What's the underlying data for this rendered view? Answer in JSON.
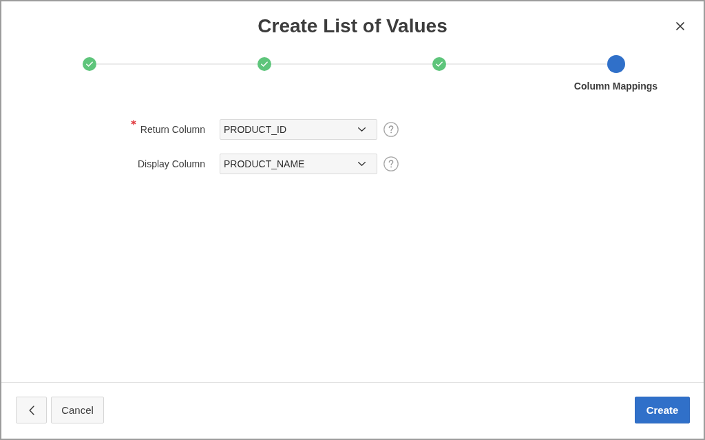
{
  "dialog": {
    "title": "Create List of Values"
  },
  "wizard": {
    "steps": [
      {
        "completed": true,
        "selected": false
      },
      {
        "completed": true,
        "selected": false
      },
      {
        "completed": true,
        "selected": false
      },
      {
        "completed": false,
        "selected": true,
        "label": "Column Mappings"
      }
    ]
  },
  "fields": [
    {
      "label": "Return Column",
      "required": true,
      "value": "PRODUCT_ID"
    },
    {
      "label": "Display Column",
      "required": false,
      "value": "PRODUCT_NAME"
    }
  ],
  "footer": {
    "buttons": [
      {
        "kind": "back"
      },
      {
        "kind": "secondary",
        "label": "Cancel"
      },
      {
        "kind": "primary",
        "label": "Create"
      }
    ]
  }
}
